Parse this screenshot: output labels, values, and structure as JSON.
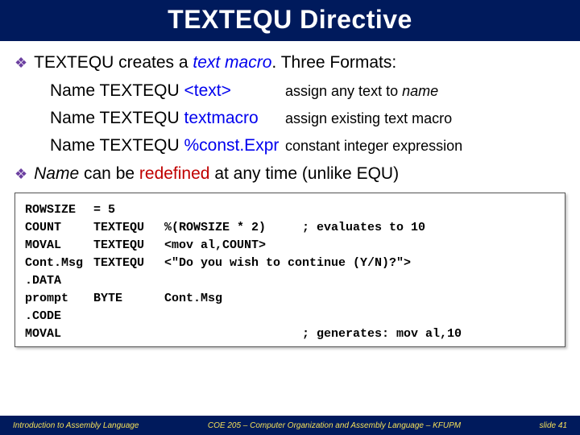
{
  "title": "TEXTEQU Directive",
  "bullets": {
    "b1_pre": "TEXTEQU creates a ",
    "b1_em": "text macro",
    "b1_post": ". Three Formats:",
    "b2_pre": "Name",
    "b2_mid": " can be ",
    "b2_red": "redefined",
    "b2_post": " at any time (unlike EQU)"
  },
  "formats": [
    {
      "left_pre": "Name TEXTEQU ",
      "left_blue": "<text>",
      "right_pre": "assign any text to ",
      "right_em": "name"
    },
    {
      "left_pre": "Name TEXTEQU ",
      "left_blue": "textmacro",
      "right_pre": "assign existing text macro",
      "right_em": ""
    },
    {
      "left_pre": "Name TEXTEQU ",
      "left_blue": "%const.Expr",
      "right_pre": "constant integer expression",
      "right_em": ""
    }
  ],
  "code": [
    {
      "a": "ROWSIZE",
      "b": "= 5",
      "c": ""
    },
    {
      "a": "COUNT",
      "b": "TEXTEQU",
      "c": "%(ROWSIZE * 2)     ; evaluates to 10"
    },
    {
      "a": "MOVAL",
      "b": "TEXTEQU",
      "c": "<mov al,COUNT>"
    },
    {
      "a": "Cont.Msg",
      "b": "TEXTEQU",
      "c": "<\"Do you wish to continue (Y/N)?\">"
    },
    {
      "a": ".DATA",
      "b": "",
      "c": ""
    },
    {
      "a": "prompt",
      "b": "BYTE",
      "c": "Cont.Msg"
    },
    {
      "a": ".CODE",
      "b": "",
      "c": ""
    },
    {
      "a": "MOVAL",
      "b": "",
      "c": "                   ; generates: mov al,10"
    }
  ],
  "footer": {
    "left": "Introduction to Assembly Language",
    "mid": "COE 205 – Computer Organization and Assembly Language – KFUPM",
    "right": "slide 41"
  }
}
